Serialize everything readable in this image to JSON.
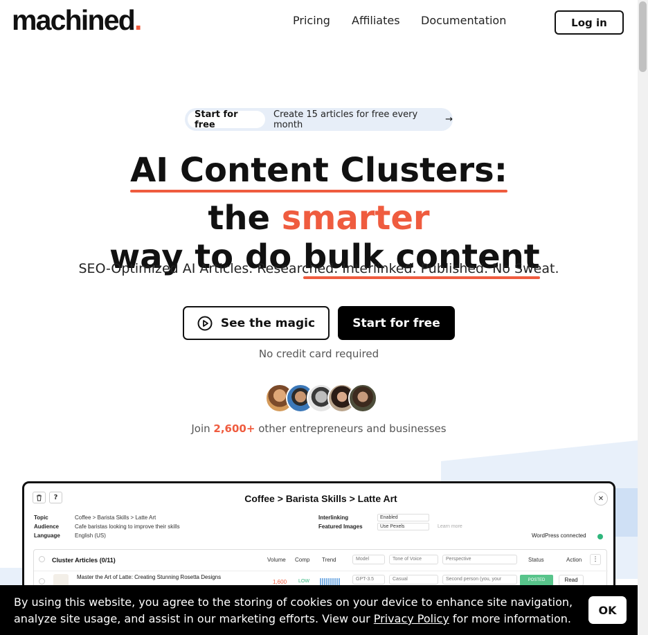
{
  "header": {
    "logo_text": "machined",
    "logo_dot": ".",
    "nav": [
      "Pricing",
      "Affiliates",
      "Documentation"
    ],
    "login_label": "Log in"
  },
  "badge": {
    "pill": "Start for free",
    "text": "Create 15 articles for free every month",
    "arrow": "→"
  },
  "hero": {
    "line1": "AI Content Clusters:",
    "line2_a": "the ",
    "line2_accent": "smarter",
    "line2_b": " way to do ",
    "line2_underlined": "bulk content",
    "subhead": "SEO-Optimized AI Articles. Researched. Interlinked. Published. No Sweat.",
    "magic_label": "See the magic",
    "start_label": "Start for free",
    "no_cc": "No credit card required",
    "join_prefix": "Join ",
    "join_count": "2,600+",
    "join_suffix": " other entrepreneurs and businesses"
  },
  "colors": {
    "accent": "#ef5c3f",
    "badge_bg": "#e7eef8",
    "connected": "#2fb67c"
  },
  "preview": {
    "trash_icon": "trash-icon",
    "help_label": "?",
    "close_label": "✕",
    "title": "Coffee > Barista Skills > Latte Art",
    "topic_label": "Topic",
    "topic_value": "Coffee > Barista Skills > Latte Art",
    "audience_label": "Audience",
    "audience_value": "Cafe baristas looking to improve their skills",
    "language_label": "Language",
    "language_value": "English (US)",
    "interlinking_label": "Interlinking",
    "interlinking_value": "Enabled",
    "images_label": "Featured Images",
    "images_value": "Use Pexels",
    "learn_more": "Learn more",
    "wp_status": "WordPress connected",
    "table_title": "Cluster Articles (0/11)",
    "columns": [
      "Volume",
      "Comp",
      "Trend",
      "Model",
      "Tone of Voice",
      "Perspective",
      "Status",
      "Action"
    ],
    "row1": {
      "title": "Master the Art of Latte: Creating Stunning Rosetta Designs",
      "volume": "1,600",
      "comp": "LOW",
      "model": "GPT-3.5",
      "tone": "Casual",
      "perspective": "Second person (you, your",
      "status": "POSTED",
      "action": "Read"
    }
  },
  "cookie": {
    "text_before": "By using this website, you agree to the storing of cookies on your device to enhance site navigation, analyze site usage, and assist in our marketing efforts. View our ",
    "link": "Privacy Policy",
    "text_after": " for more information.",
    "ok_label": "OK"
  }
}
